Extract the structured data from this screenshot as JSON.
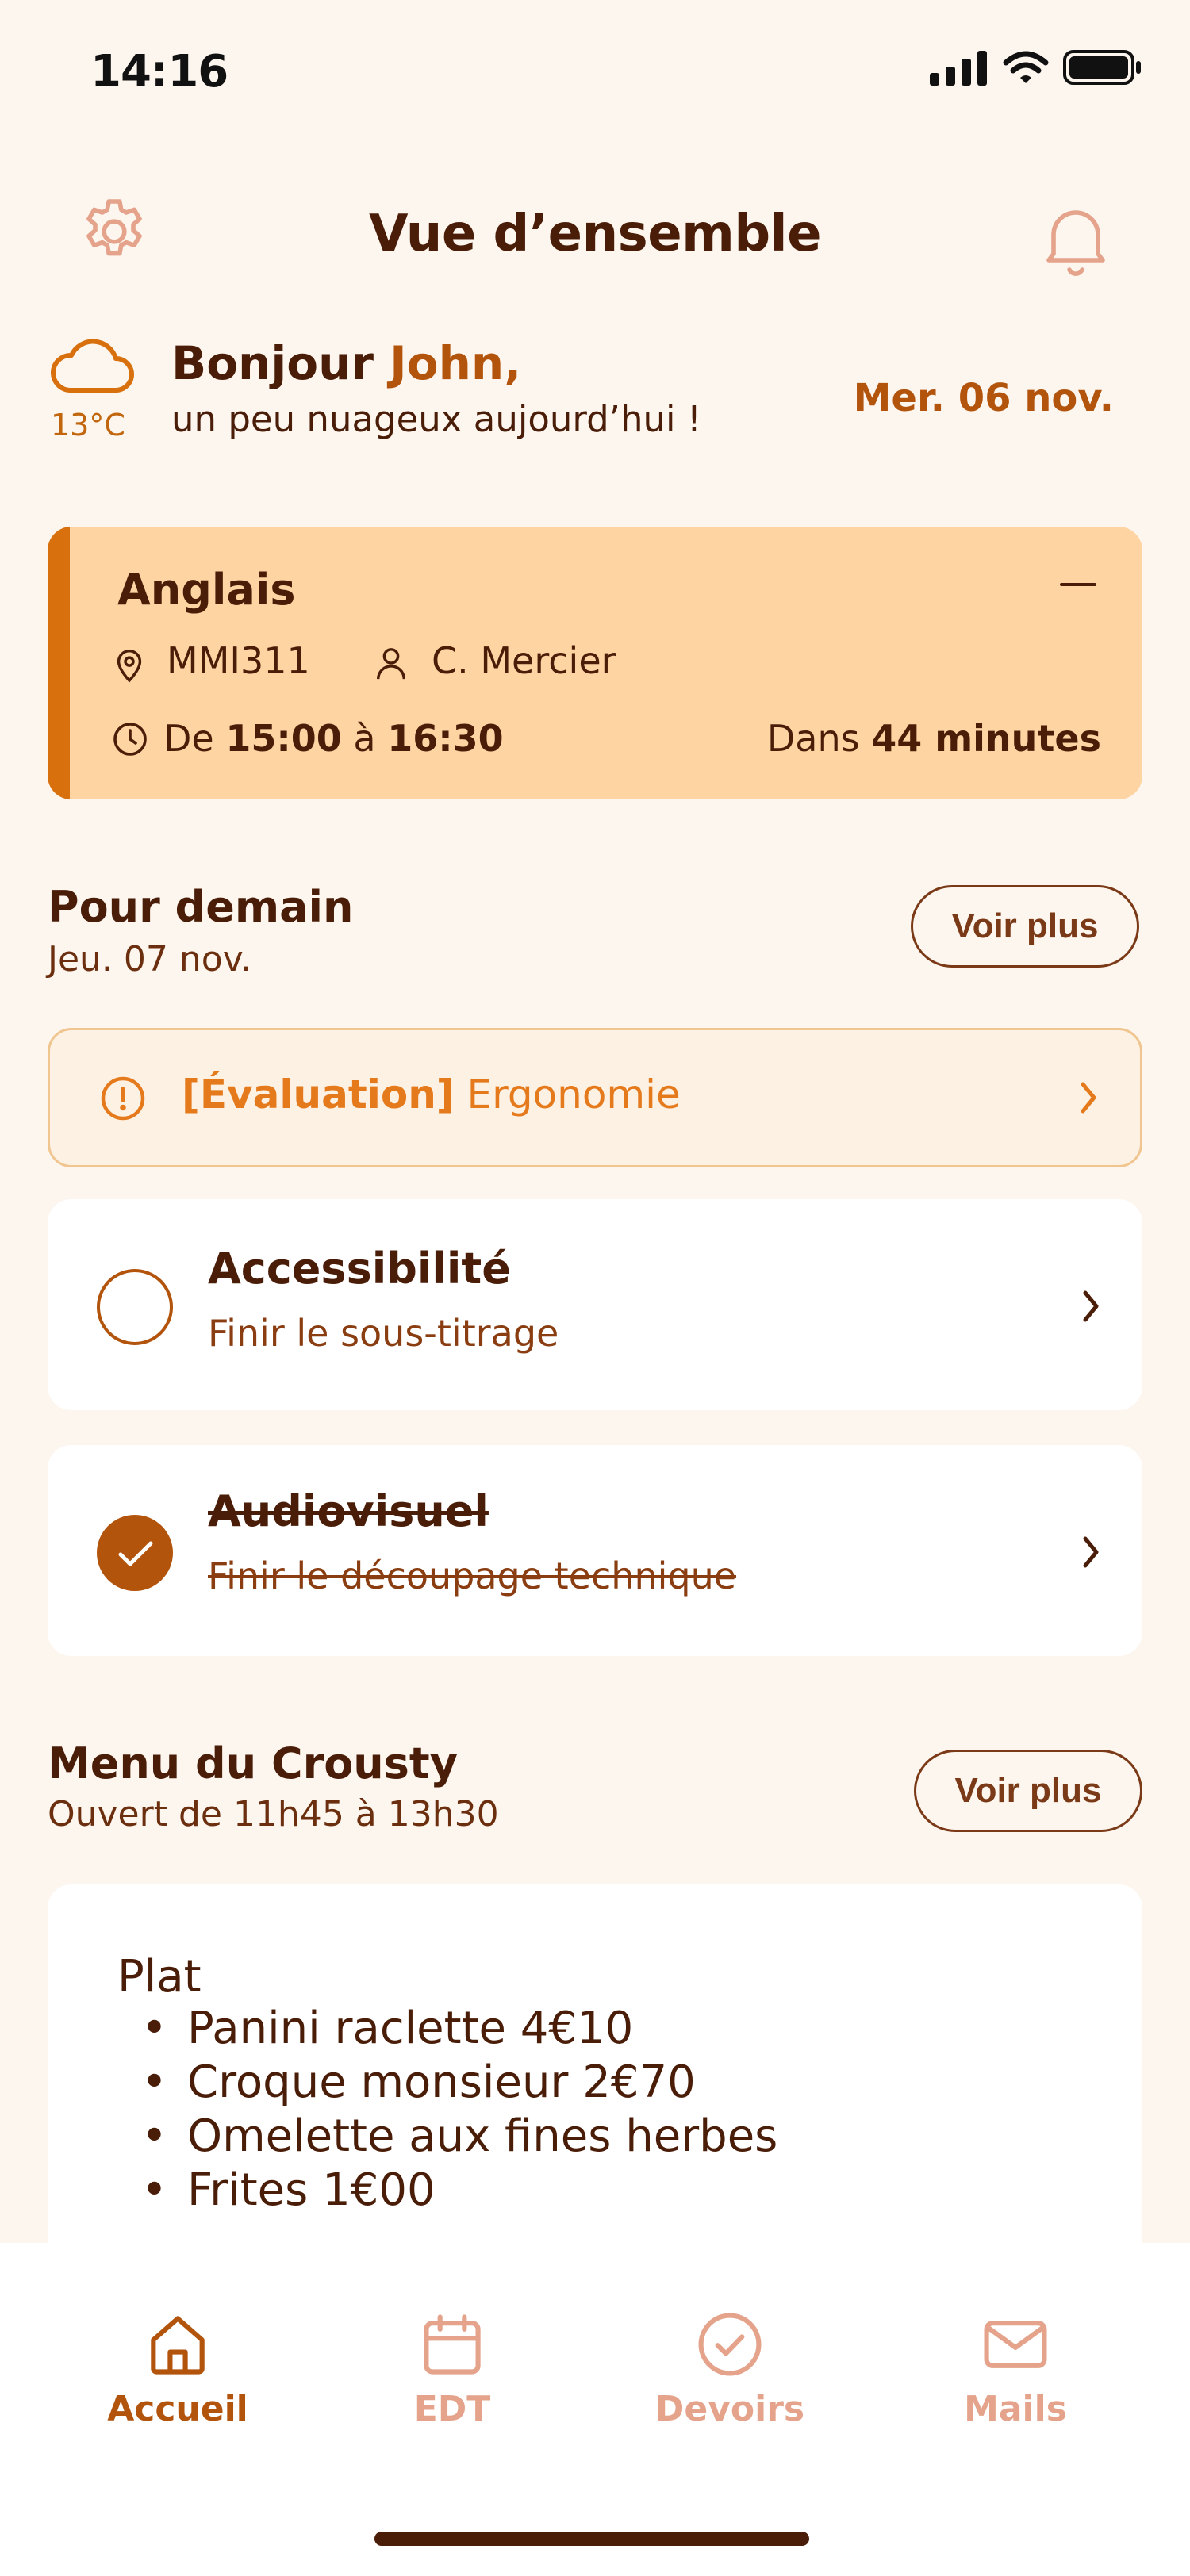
{
  "status_bar": {
    "time": "14:16"
  },
  "header": {
    "title": "Vue d’ensemble"
  },
  "greeting": {
    "hello": "Bonjour ",
    "name": "John,",
    "weather_text": "un peu nuageux aujourd’hui !",
    "temperature": "13°C",
    "date": "Mer. 06 nov."
  },
  "current_course": {
    "name": "Anglais",
    "room": "MMI311",
    "teacher": "C. Mercier",
    "time_prefix": "De ",
    "start": "15:00",
    "time_mid": " à ",
    "end": "16:30",
    "countdown_prefix": "Dans ",
    "countdown": "44 minutes"
  },
  "tomorrow": {
    "title": "Pour demain",
    "date": "Jeu. 07 nov.",
    "more_label": "Voir plus",
    "evaluation": {
      "tag": "[Évaluation]",
      "subject": " Ergonomie"
    },
    "tasks": [
      {
        "title": "Accessibilité",
        "description": "Finir le sous-titrage",
        "done": false
      },
      {
        "title": "Audiovisuel",
        "description": "Finir le découpage technique",
        "done": true
      }
    ]
  },
  "crousty": {
    "title": "Menu du Crousty",
    "hours": "Ouvert de 11h45 à 13h30",
    "more_label": "Voir plus",
    "section": "Plat",
    "items": [
      "Panini raclette 4€10",
      "Croque monsieur 2€70",
      "Omelette aux fines herbes",
      "Frites 1€00"
    ]
  },
  "tabs": [
    {
      "label": "Accueil",
      "icon": "home-icon",
      "active": true
    },
    {
      "label": "EDT",
      "icon": "calendar-icon",
      "active": false
    },
    {
      "label": "Devoirs",
      "icon": "check-circle-icon",
      "active": false
    },
    {
      "label": "Mails",
      "icon": "mail-icon",
      "active": false
    }
  ],
  "colors": {
    "primary": "#b3540d",
    "accent": "#d7700d",
    "text": "#4a1d08",
    "card_highlight": "#fed4a3",
    "background": "#fdf6ef",
    "inactive_tab": "#e4a38a"
  }
}
